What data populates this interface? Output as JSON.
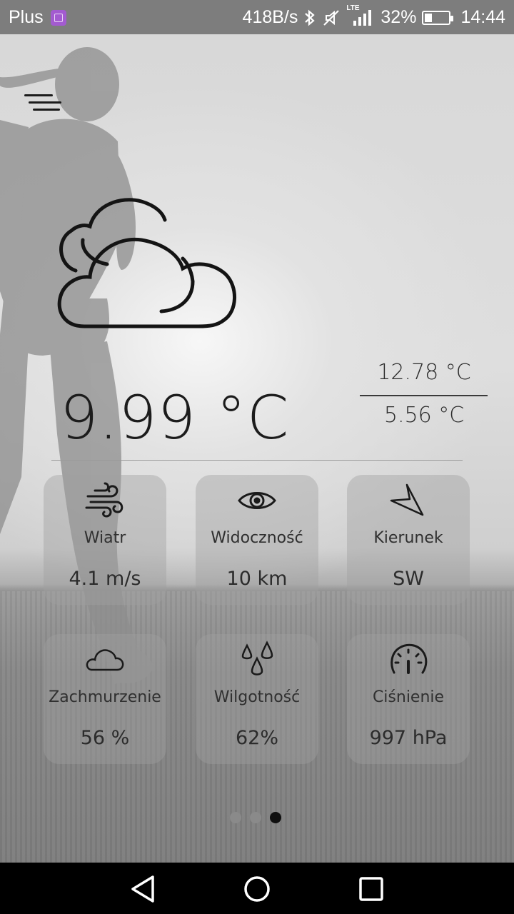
{
  "statusbar": {
    "carrier": "Plus",
    "speed": "418B/s",
    "network": "LTE",
    "battery": "32%",
    "battery_level": 0.32,
    "time": "14:44",
    "icons": [
      "gallery-notification-icon",
      "bluetooth-icon",
      "mute-icon",
      "signal-icon",
      "battery-icon"
    ]
  },
  "weather": {
    "condition_icon": "cloudy-icon",
    "current_temp": "9.99 °C",
    "max_temp": "12.78 °C",
    "min_temp": "5.56 °C"
  },
  "tiles": [
    {
      "icon": "wind-icon",
      "label": "Wiatr",
      "value": "4.1 m/s"
    },
    {
      "icon": "eye-icon",
      "label": "Widoczność",
      "value": "10 km"
    },
    {
      "icon": "direction-arrow-icon",
      "label": "Kierunek",
      "value": "SW"
    },
    {
      "icon": "cloud-icon",
      "label": "Zachmurzenie",
      "value": "56 %"
    },
    {
      "icon": "humidity-drops-icon",
      "label": "Wilgotność",
      "value": "62%"
    },
    {
      "icon": "pressure-gauge-icon",
      "label": "Ciśnienie",
      "value": "997 hPa"
    }
  ],
  "pager": {
    "pages": 3,
    "active_index": 2
  },
  "colors": {
    "statusbar_bg": "#7d7d7d",
    "tile_bg": "rgba(160,160,160,0.42)",
    "text_dark": "#1c1c1c",
    "dot_active": "#0f0f0f",
    "dot_inactive": "#8a8a8a"
  }
}
